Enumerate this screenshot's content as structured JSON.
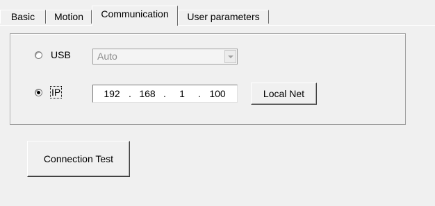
{
  "tabs": [
    {
      "label": "Basic"
    },
    {
      "label": "Motion"
    },
    {
      "label": "Communication"
    },
    {
      "label": "User parameters"
    }
  ],
  "active_tab": "Communication",
  "connection": {
    "usb_label": "USB",
    "usb_selected": false,
    "usb_mode_value": "Auto",
    "ip_label": "IP",
    "ip_selected": true,
    "ip_address": {
      "octet1": "192",
      "octet2": "168",
      "octet3": "1",
      "octet4": "100",
      "separator": "."
    },
    "local_net_label": "Local Net"
  },
  "actions": {
    "connection_test_label": "Connection Test"
  },
  "icons": {
    "select_dropdown": "chevron-down-icon",
    "radio_unchecked": "radio-unchecked-icon",
    "radio_checked": "radio-checked-icon"
  },
  "colors": {
    "window_background": "#f0f0f0",
    "disabled_text": "#8c8c8c",
    "border": "#a0a0a0"
  }
}
